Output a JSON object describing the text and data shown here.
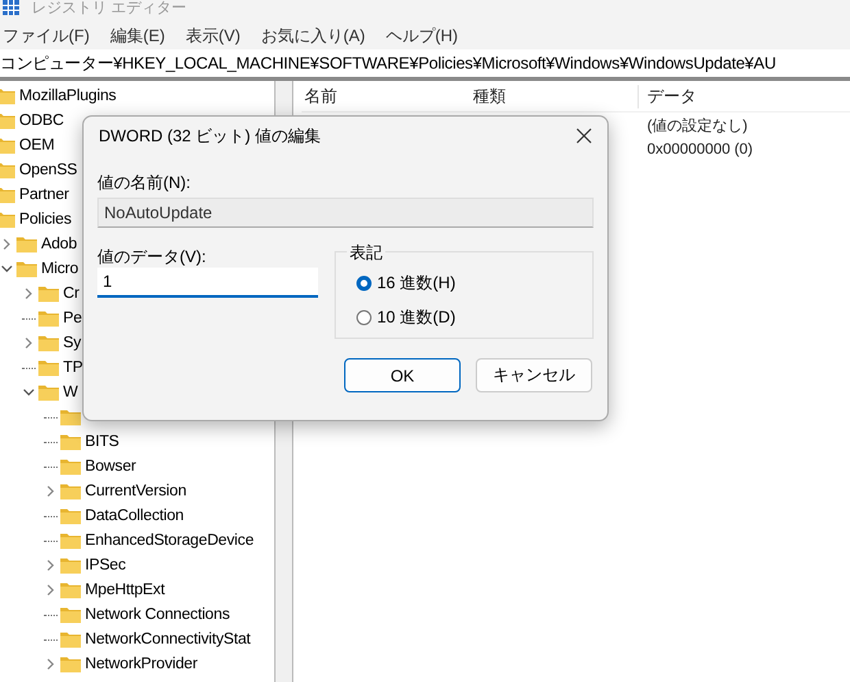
{
  "window": {
    "title": "レジストリ エディター"
  },
  "menu": [
    {
      "label": "ファイル(F)"
    },
    {
      "label": "編集(E)"
    },
    {
      "label": "表示(V)"
    },
    {
      "label": "お気に入り(A)"
    },
    {
      "label": "ヘルプ(H)"
    }
  ],
  "address": "コンピューター¥HKEY_LOCAL_MACHINE¥SOFTWARE¥Policies¥Microsoft¥Windows¥WindowsUpdate¥AU",
  "tree": [
    {
      "label": "MozillaPlugins"
    },
    {
      "label": "ODBC"
    },
    {
      "label": "OEM"
    },
    {
      "label": "OpenSS"
    },
    {
      "label": "Partner"
    },
    {
      "label": "Policies",
      "children": [
        {
          "label": "Adob",
          "kind": "branch",
          "expanded": false
        },
        {
          "label": "Micro",
          "kind": "branch",
          "expanded": true,
          "children": [
            {
              "label": "Cr",
              "kind": "branch",
              "expanded": false
            },
            {
              "label": "Pe",
              "kind": "leaf"
            },
            {
              "label": "Sy",
              "kind": "branch",
              "expanded": false
            },
            {
              "label": "TP",
              "kind": "leaf"
            },
            {
              "label": "W",
              "kind": "branch",
              "expanded": true,
              "children": [
                {
                  "kind": "leaf"
                },
                {
                  "label": "BITS",
                  "kind": "leaf"
                },
                {
                  "label": "Bowser",
                  "kind": "leaf"
                },
                {
                  "label": "CurrentVersion",
                  "kind": "branch",
                  "expanded": false
                },
                {
                  "label": "DataCollection",
                  "kind": "leaf"
                },
                {
                  "label": "EnhancedStorageDevice",
                  "kind": "leaf"
                },
                {
                  "label": "IPSec",
                  "kind": "branch",
                  "expanded": false
                },
                {
                  "label": "MpeHttpExt",
                  "kind": "branch",
                  "expanded": false
                },
                {
                  "label": "Network Connections",
                  "kind": "leaf"
                },
                {
                  "label": "NetworkConnectivityStat",
                  "kind": "leaf"
                },
                {
                  "label": "NetworkProvider",
                  "kind": "branch",
                  "expanded": false
                }
              ]
            }
          ]
        }
      ]
    }
  ],
  "list": {
    "columns": [
      "名前",
      "種類",
      "データ"
    ],
    "rows": [
      {
        "data": "(値の設定なし)"
      },
      {
        "data": "0x00000000 (0)"
      }
    ]
  },
  "dialog": {
    "title": "DWORD (32 ビット) 値の編集",
    "name_label": "値の名前(N):",
    "name_value": "NoAutoUpdate",
    "data_label": "値のデータ(V):",
    "data_value": "1",
    "base_group": "表記",
    "bases": [
      {
        "label": "16 進数(H)",
        "selected": true
      },
      {
        "label": "10 進数(D)",
        "selected": false
      }
    ],
    "buttons": [
      {
        "label": "OK",
        "default": true
      },
      {
        "label": "キャンセル",
        "default": false
      }
    ]
  }
}
